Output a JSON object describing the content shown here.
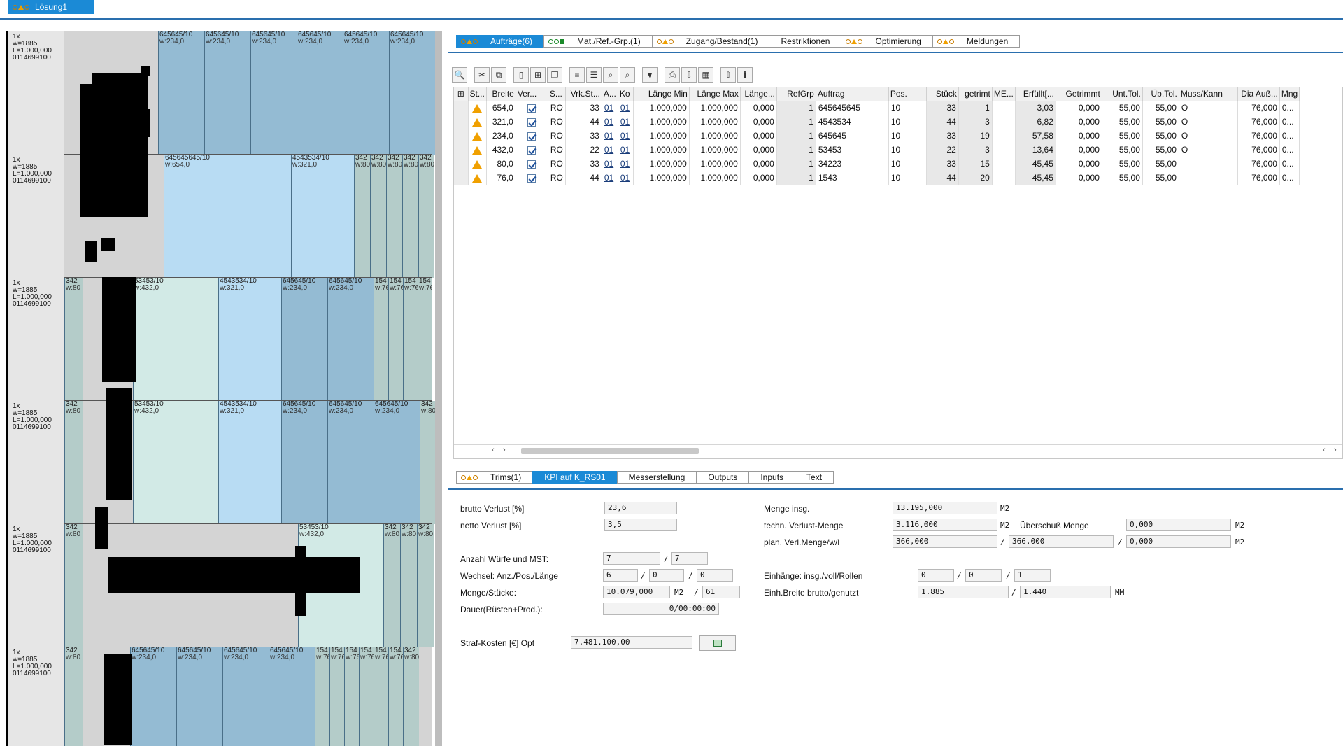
{
  "top_tab": {
    "label": "Lösung1"
  },
  "rows": [
    {
      "count": "1x",
      "w": "w=1885",
      "L": "L=1.000,000",
      "id": "0114699100"
    },
    {
      "count": "1x",
      "w": "w=1885",
      "L": "L=1.000,000",
      "id": "0114699100"
    },
    {
      "count": "1x",
      "w": "w=1885",
      "L": "L=1.000,000",
      "id": "0114699100"
    },
    {
      "count": "1x",
      "w": "w=1885",
      "L": "L=1.000,000",
      "id": "0114699100"
    },
    {
      "count": "1x",
      "w": "w=1885",
      "L": "L=1.000,000",
      "id": "0114699100"
    },
    {
      "count": "1x",
      "w": "w=1885",
      "L": "L=1.000,000",
      "id": "0114699100"
    }
  ],
  "blocks": [
    [
      {
        "t": "645645/10",
        "w": "w:234,0"
      },
      {
        "t": "645645/10",
        "w": "w:234,0"
      },
      {
        "t": "645645/10",
        "w": "w:234,0"
      },
      {
        "t": "645645/10",
        "w": "w:234,0"
      },
      {
        "t": "645645/10",
        "w": "w:234,0"
      },
      {
        "t": "645645/10",
        "w": "w:234,0"
      }
    ],
    [
      {
        "t": "645645645/10",
        "w": "w:654,0"
      },
      {
        "t": "4543534/10",
        "w": "w:321,0"
      },
      {
        "t": "342",
        "w": "w:80"
      },
      {
        "t": "342",
        "w": "w:80"
      },
      {
        "t": "342",
        "w": "w:80"
      },
      {
        "t": "342",
        "w": "w:80"
      },
      {
        "t": "342",
        "w": "w:80"
      }
    ],
    [
      {
        "t": "342",
        "w": "w:80"
      },
      {
        "t": "53453/10",
        "w": "w:432,0"
      },
      {
        "t": "4543534/10",
        "w": "w:321,0"
      },
      {
        "t": "645645/10",
        "w": "w:234,0"
      },
      {
        "t": "645645/10",
        "w": "w:234,0"
      },
      {
        "t": "154",
        "w": "w:76"
      },
      {
        "t": "154",
        "w": "w:76"
      },
      {
        "t": "154",
        "w": "w:76"
      },
      {
        "t": "154",
        "w": "w:76"
      }
    ],
    [
      {
        "t": "342",
        "w": "w:80"
      },
      {
        "t": "53453/10",
        "w": "w:432,0"
      },
      {
        "t": "4543534/10",
        "w": "w:321,0"
      },
      {
        "t": "645645/10",
        "w": "w:234,0"
      },
      {
        "t": "645645/10",
        "w": "w:234,0"
      },
      {
        "t": "645645/10",
        "w": "w:234,0"
      },
      {
        "t": "342",
        "w": "w:80"
      }
    ],
    [
      {
        "t": "342",
        "w": "w:80"
      },
      {
        "t": "53453/10",
        "w": "w:432,0"
      },
      {
        "t": "342",
        "w": "w:80"
      },
      {
        "t": "342",
        "w": "w:80"
      },
      {
        "t": "342",
        "w": "w:80"
      }
    ],
    [
      {
        "t": "342",
        "w": "w:80"
      },
      {
        "t": "645645/10",
        "w": "w:234,0"
      },
      {
        "t": "645645/10",
        "w": "w:234,0"
      },
      {
        "t": "645645/10",
        "w": "w:234,0"
      },
      {
        "t": "645645/10",
        "w": "w:234,0"
      },
      {
        "t": "154",
        "w": "w:76"
      },
      {
        "t": "154",
        "w": "w:76"
      },
      {
        "t": "154",
        "w": "w:76"
      },
      {
        "t": "154",
        "w": "w:76"
      },
      {
        "t": "154",
        "w": "w:76"
      },
      {
        "t": "154",
        "w": "w:76"
      },
      {
        "t": "342",
        "w": "w:80"
      }
    ]
  ],
  "upper_tabs": [
    {
      "label": "Aufträge(6)",
      "lights": "tri"
    },
    {
      "label": "Mat./Ref.-Grp.(1)",
      "lights": "green"
    },
    {
      "label": "Zugang/Bestand(1)",
      "lights": "tri"
    },
    {
      "label": "Restriktionen",
      "lights": ""
    },
    {
      "label": "Optimierung",
      "lights": "tri"
    },
    {
      "label": "Meldungen",
      "lights": "tri"
    }
  ],
  "toolbar_icons": [
    "details-icon",
    "cut-icon",
    "copy-icon",
    "new-row-icon",
    "insert-row-icon",
    "duplicate-row-icon",
    "sort-icon",
    "filter-sort-icon",
    "find-icon",
    "find-next-icon",
    "filter-icon",
    "print-icon",
    "export-icon",
    "layout-icon",
    "upload-icon",
    "info-icon"
  ],
  "table": {
    "headers": [
      "St...",
      "Breite",
      "Ver...",
      "S...",
      "Vrk.St...",
      "A...",
      "Ko",
      "Länge Min",
      "Länge Max",
      "Länge...",
      "RefGrp",
      "Auftrag",
      "Pos.",
      "Stück",
      "getrimt",
      "ME...",
      "Erfüllt[...",
      "Getrimmt",
      "Unt.Tol.",
      "Üb.Tol.",
      "Muss/Kann",
      "Dia Auß...",
      "Mng"
    ],
    "rows": [
      [
        "654,0",
        "RO",
        "33",
        "01",
        "01",
        "1.000,000",
        "1.000,000",
        "0,000",
        "1",
        "645645645",
        "10",
        "33",
        "1",
        "",
        "3,03",
        "0,000",
        "55,00",
        "55,00",
        "O",
        "76,000",
        "0..."
      ],
      [
        "321,0",
        "RO",
        "44",
        "01",
        "01",
        "1.000,000",
        "1.000,000",
        "0,000",
        "1",
        "4543534",
        "10",
        "44",
        "3",
        "",
        "6,82",
        "0,000",
        "55,00",
        "55,00",
        "O",
        "76,000",
        "0..."
      ],
      [
        "234,0",
        "RO",
        "33",
        "01",
        "01",
        "1.000,000",
        "1.000,000",
        "0,000",
        "1",
        "645645",
        "10",
        "33",
        "19",
        "",
        "57,58",
        "0,000",
        "55,00",
        "55,00",
        "O",
        "76,000",
        "0..."
      ],
      [
        "432,0",
        "RO",
        "22",
        "01",
        "01",
        "1.000,000",
        "1.000,000",
        "0,000",
        "1",
        "53453",
        "10",
        "22",
        "3",
        "",
        "13,64",
        "0,000",
        "55,00",
        "55,00",
        "O",
        "76,000",
        "0..."
      ],
      [
        "80,0",
        "RO",
        "33",
        "01",
        "01",
        "1.000,000",
        "1.000,000",
        "0,000",
        "1",
        "34223",
        "10",
        "33",
        "15",
        "",
        "45,45",
        "0,000",
        "55,00",
        "55,00",
        "",
        "76,000",
        "0..."
      ],
      [
        "76,0",
        "RO",
        "44",
        "01",
        "01",
        "1.000,000",
        "1.000,000",
        "0,000",
        "1",
        "1543",
        "10",
        "44",
        "20",
        "",
        "45,45",
        "0,000",
        "55,00",
        "55,00",
        "",
        "76,000",
        "0..."
      ]
    ]
  },
  "lower_tabs": [
    {
      "label": "Trims(1)",
      "lights": "tri"
    },
    {
      "label": "KPI  auf K_RS01",
      "lights": ""
    },
    {
      "label": "Messerstellung",
      "lights": ""
    },
    {
      "label": "Outputs",
      "lights": ""
    },
    {
      "label": "Inputs",
      "lights": ""
    },
    {
      "label": "Text",
      "lights": ""
    }
  ],
  "kpi": {
    "brutto_label": "brutto Verlust [%]",
    "brutto": "23,6",
    "netto_label": "netto Verlust [%]",
    "netto": "3,5",
    "wuerfe_label": "Anzahl Würfe und MST:",
    "wuerfe1": "7",
    "wuerfe2": "7",
    "wechsel_label": "Wechsel: Anz./Pos./Länge",
    "wechsel1": "6",
    "wechsel2": "0",
    "wechsel3": "0",
    "menge_label": "Menge/Stücke:",
    "menge": "10.079,000",
    "menge_unit": "M2",
    "stueck": "61",
    "dauer_label": "Dauer(Rüsten+Prod.):",
    "dauer": "0/00:00:00",
    "straf_label": "Straf-Kosten [€] Opt",
    "straf": "7.481.100,00",
    "mengeinsg_label": "Menge insg.",
    "mengeinsg": "13.195,000",
    "mengeinsg_unit": "M2",
    "techn_label": "techn. Verlust-Menge",
    "techn": "3.116,000",
    "techn_unit": "M2",
    "ueber_label": "Überschuß Menge",
    "ueber": "0,000",
    "ueber_unit": "M2",
    "plan_label": "plan. Verl.Menge/w/l",
    "plan1": "366,000",
    "plan2": "366,000",
    "plan3": "0,000",
    "plan_unit": "M2",
    "einh_label": "Einhänge: insg./voll/Rollen",
    "einh1": "0",
    "einh2": "0",
    "einh3": "1",
    "breite_label": "Einh.Breite brutto/genutzt",
    "breite1": "1.885",
    "breite2": "1.440",
    "breite_unit": "MM",
    "slash": "/"
  },
  "colors": {
    "accent": "#1b8ad6",
    "warn": "#f0a000"
  }
}
